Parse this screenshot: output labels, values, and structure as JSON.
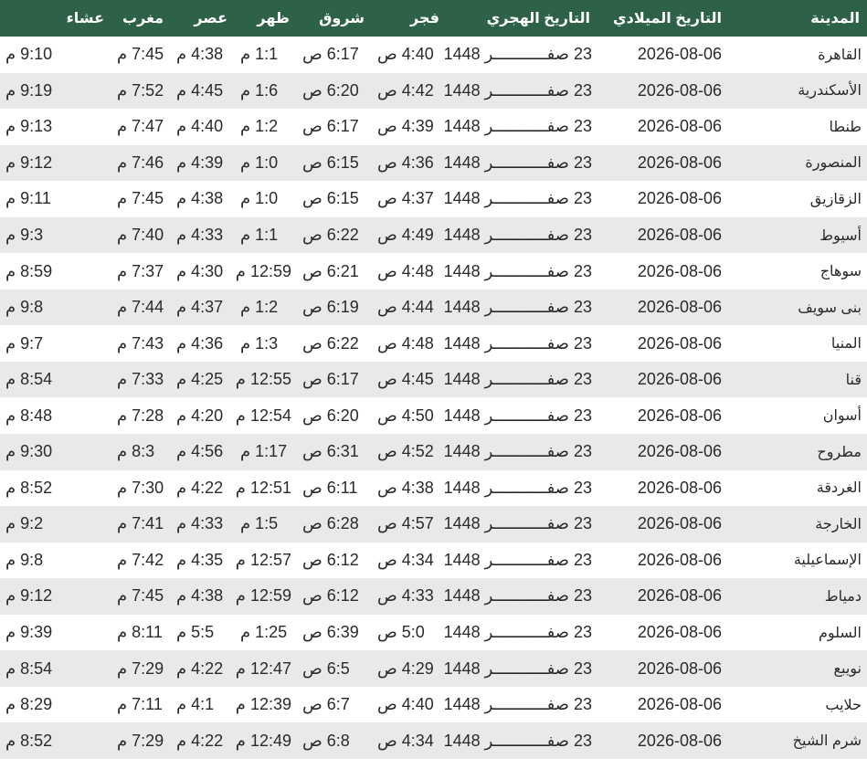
{
  "headers": {
    "city": "المدينة",
    "gregorian": "التاريخ الميلادي",
    "hijri": "التاريخ الهجري",
    "fajr": "فجر",
    "sunrise": "شروق",
    "dhuhr": "ظهر",
    "asr": "عصر",
    "maghrib": "مغرب",
    "isha": "عشاء"
  },
  "rows": [
    {
      "city": "القاهرة",
      "greg": "2026-08-06",
      "hijri": "23 صفـــــــــــر 1448",
      "fajr": "4:40 ص",
      "sunrise": "6:17 ص",
      "dhuhr": "1:1 م",
      "asr": "4:38 م",
      "maghrib": "7:45 م",
      "isha": "9:10 م"
    },
    {
      "city": "الأسكندرية",
      "greg": "2026-08-06",
      "hijri": "23 صفـــــــــــر 1448",
      "fajr": "4:42 ص",
      "sunrise": "6:20 ص",
      "dhuhr": "1:6 م",
      "asr": "4:45 م",
      "maghrib": "7:52 م",
      "isha": "9:19 م"
    },
    {
      "city": "طنطا",
      "greg": "2026-08-06",
      "hijri": "23 صفـــــــــــر 1448",
      "fajr": "4:39 ص",
      "sunrise": "6:17 ص",
      "dhuhr": "1:2 م",
      "asr": "4:40 م",
      "maghrib": "7:47 م",
      "isha": "9:13 م"
    },
    {
      "city": "المنصورة",
      "greg": "2026-08-06",
      "hijri": "23 صفـــــــــــر 1448",
      "fajr": "4:36 ص",
      "sunrise": "6:15 ص",
      "dhuhr": "1:0 م",
      "asr": "4:39 م",
      "maghrib": "7:46 م",
      "isha": "9:12 م"
    },
    {
      "city": "الزقازيق",
      "greg": "2026-08-06",
      "hijri": "23 صفـــــــــــر 1448",
      "fajr": "4:37 ص",
      "sunrise": "6:15 ص",
      "dhuhr": "1:0 م",
      "asr": "4:38 م",
      "maghrib": "7:45 م",
      "isha": "9:11 م"
    },
    {
      "city": "أسيوط",
      "greg": "2026-08-06",
      "hijri": "23 صفـــــــــــر 1448",
      "fajr": "4:49 ص",
      "sunrise": "6:22 ص",
      "dhuhr": "1:1 م",
      "asr": "4:33 م",
      "maghrib": "7:40 م",
      "isha": "9:3 م"
    },
    {
      "city": "سوهاج",
      "greg": "2026-08-06",
      "hijri": "23 صفـــــــــــر 1448",
      "fajr": "4:48 ص",
      "sunrise": "6:21 ص",
      "dhuhr": "12:59 م",
      "asr": "4:30 م",
      "maghrib": "7:37 م",
      "isha": "8:59 م"
    },
    {
      "city": "بنى سويف",
      "greg": "2026-08-06",
      "hijri": "23 صفـــــــــــر 1448",
      "fajr": "4:44 ص",
      "sunrise": "6:19 ص",
      "dhuhr": "1:2 م",
      "asr": "4:37 م",
      "maghrib": "7:44 م",
      "isha": "9:8 م"
    },
    {
      "city": "المنيا",
      "greg": "2026-08-06",
      "hijri": "23 صفـــــــــــر 1448",
      "fajr": "4:48 ص",
      "sunrise": "6:22 ص",
      "dhuhr": "1:3 م",
      "asr": "4:36 م",
      "maghrib": "7:43 م",
      "isha": "9:7 م"
    },
    {
      "city": "قنا",
      "greg": "2026-08-06",
      "hijri": "23 صفـــــــــــر 1448",
      "fajr": "4:45 ص",
      "sunrise": "6:17 ص",
      "dhuhr": "12:55 م",
      "asr": "4:25 م",
      "maghrib": "7:33 م",
      "isha": "8:54 م"
    },
    {
      "city": "أسوان",
      "greg": "2026-08-06",
      "hijri": "23 صفـــــــــــر 1448",
      "fajr": "4:50 ص",
      "sunrise": "6:20 ص",
      "dhuhr": "12:54 م",
      "asr": "4:20 م",
      "maghrib": "7:28 م",
      "isha": "8:48 م"
    },
    {
      "city": "مطروح",
      "greg": "2026-08-06",
      "hijri": "23 صفـــــــــــر 1448",
      "fajr": "4:52 ص",
      "sunrise": "6:31 ص",
      "dhuhr": "1:17 م",
      "asr": "4:56 م",
      "maghrib": "8:3 م",
      "isha": "9:30 م"
    },
    {
      "city": "الغردقة",
      "greg": "2026-08-06",
      "hijri": "23 صفـــــــــــر 1448",
      "fajr": "4:38 ص",
      "sunrise": "6:11 ص",
      "dhuhr": "12:51 م",
      "asr": "4:22 م",
      "maghrib": "7:30 م",
      "isha": "8:52 م"
    },
    {
      "city": "الخارجة",
      "greg": "2026-08-06",
      "hijri": "23 صفـــــــــــر 1448",
      "fajr": "4:57 ص",
      "sunrise": "6:28 ص",
      "dhuhr": "1:5 م",
      "asr": "4:33 م",
      "maghrib": "7:41 م",
      "isha": "9:2 م"
    },
    {
      "city": "الإسماعيلية",
      "greg": "2026-08-06",
      "hijri": "23 صفـــــــــــر 1448",
      "fajr": "4:34 ص",
      "sunrise": "6:12 ص",
      "dhuhr": "12:57 م",
      "asr": "4:35 م",
      "maghrib": "7:42 م",
      "isha": "9:8 م"
    },
    {
      "city": "دمياط",
      "greg": "2026-08-06",
      "hijri": "23 صفـــــــــــر 1448",
      "fajr": "4:33 ص",
      "sunrise": "6:12 ص",
      "dhuhr": "12:59 م",
      "asr": "4:38 م",
      "maghrib": "7:45 م",
      "isha": "9:12 م"
    },
    {
      "city": "السلوم",
      "greg": "2026-08-06",
      "hijri": "23 صفـــــــــــر 1448",
      "fajr": "5:0 ص",
      "sunrise": "6:39 ص",
      "dhuhr": "1:25 م",
      "asr": "5:5 م",
      "maghrib": "8:11 م",
      "isha": "9:39 م"
    },
    {
      "city": "نويبع",
      "greg": "2026-08-06",
      "hijri": "23 صفـــــــــــر 1448",
      "fajr": "4:29 ص",
      "sunrise": "6:5 ص",
      "dhuhr": "12:47 م",
      "asr": "4:22 م",
      "maghrib": "7:29 م",
      "isha": "8:54 م"
    },
    {
      "city": "حلايب",
      "greg": "2026-08-06",
      "hijri": "23 صفـــــــــــر 1448",
      "fajr": "4:40 ص",
      "sunrise": "6:7 ص",
      "dhuhr": "12:39 م",
      "asr": "4:1 م",
      "maghrib": "7:11 م",
      "isha": "8:29 م"
    },
    {
      "city": "شرم الشيخ",
      "greg": "2026-08-06",
      "hijri": "23 صفـــــــــــر 1448",
      "fajr": "4:34 ص",
      "sunrise": "6:8 ص",
      "dhuhr": "12:49 م",
      "asr": "4:22 م",
      "maghrib": "7:29 م",
      "isha": "8:52 م"
    }
  ],
  "colors": {
    "header_bg": "#2d6249",
    "row_alt_bg": "#e7eae9"
  }
}
